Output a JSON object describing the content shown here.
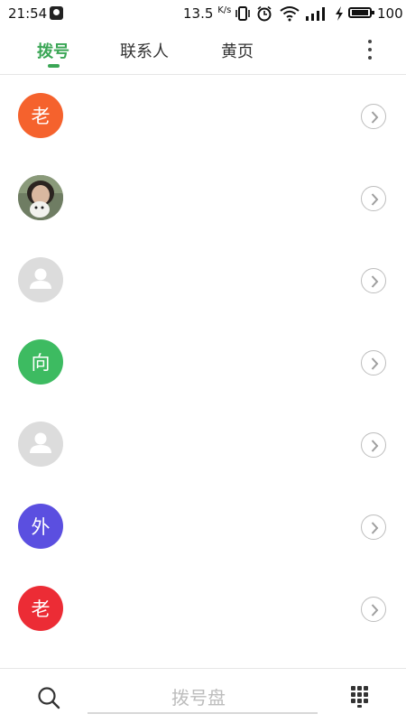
{
  "status_bar": {
    "time": "21:54",
    "net_speed": "13.5",
    "net_speed_unit": "K/s",
    "battery": "100",
    "icons": [
      "notification-icon",
      "vibrate-icon",
      "alarm-icon",
      "wifi-icon",
      "signal-icon",
      "charging-icon",
      "battery-icon"
    ]
  },
  "tabs": [
    {
      "label": "拨号",
      "active": true
    },
    {
      "label": "联系人",
      "active": false
    },
    {
      "label": "黄页",
      "active": false
    }
  ],
  "colors": {
    "accent": "#3aa655",
    "avatar_orange": "#f5622d",
    "avatar_green": "#3dbb61",
    "avatar_purple": "#5b4fe0",
    "avatar_red": "#ec2c35",
    "avatar_placeholder": "#dcdcdc"
  },
  "contacts": [
    {
      "initial": "老",
      "type": "letter",
      "color": "#f5622d"
    },
    {
      "initial": "",
      "type": "photo",
      "color": "#7a8a6e"
    },
    {
      "initial": "",
      "type": "placeholder",
      "color": "#dcdcdc"
    },
    {
      "initial": "向",
      "type": "letter",
      "color": "#3dbb61"
    },
    {
      "initial": "",
      "type": "placeholder",
      "color": "#dcdcdc"
    },
    {
      "initial": "外",
      "type": "letter",
      "color": "#5b4fe0"
    },
    {
      "initial": "老",
      "type": "letter",
      "color": "#ec2c35"
    }
  ],
  "bottom_bar": {
    "dialpad_label": "拨号盘"
  }
}
